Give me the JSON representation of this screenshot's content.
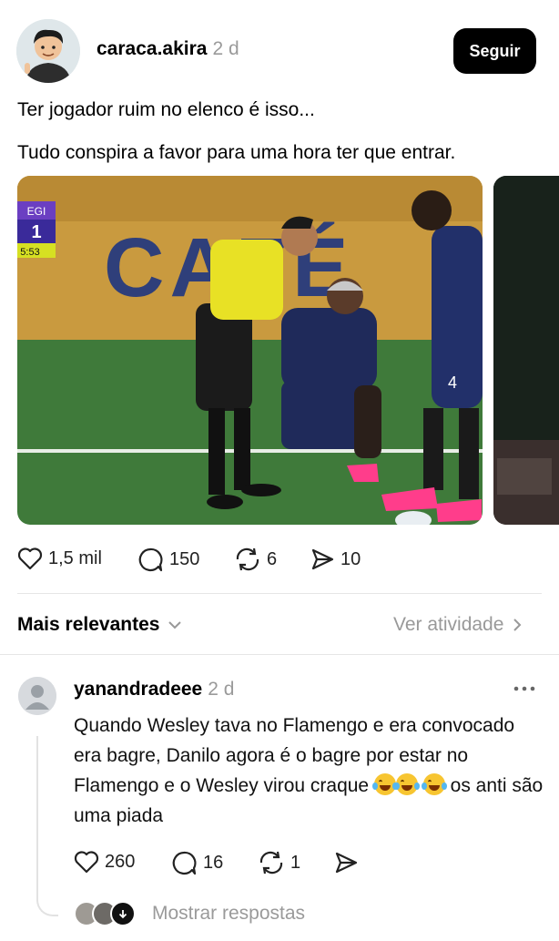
{
  "post": {
    "username": "caraca.akira",
    "time": "2 d",
    "follow_label": "Seguir",
    "line1": "Ter jogador ruim no elenco é isso...",
    "line2": "Tudo conspira a favor para uma hora ter que entrar.",
    "scoreboard": {
      "team": "EGI",
      "score": "1",
      "clock": "5:53"
    },
    "board_text": "CAFÉ",
    "shirt_number": "4",
    "likes": "1,5 mil",
    "comments": "150",
    "reposts": "6",
    "shares": "10"
  },
  "sort": {
    "label": "Mais relevantes",
    "activity": "Ver atividade"
  },
  "comment": {
    "username": "yanandradeee",
    "time": "2 d",
    "text_main": "Quando Wesley tava no Flamengo e era convocado era bagre, Danilo agora é o bagre por estar no Flamengo e o Wesley virou craque",
    "text_tail": "os anti são uma piada",
    "likes": "260",
    "comments": "16",
    "reposts": "1",
    "show_replies": "Mostrar respostas"
  },
  "colors": {
    "accent": "#000000",
    "muted": "#9a9a9a",
    "divider": "#e6e6e6"
  }
}
